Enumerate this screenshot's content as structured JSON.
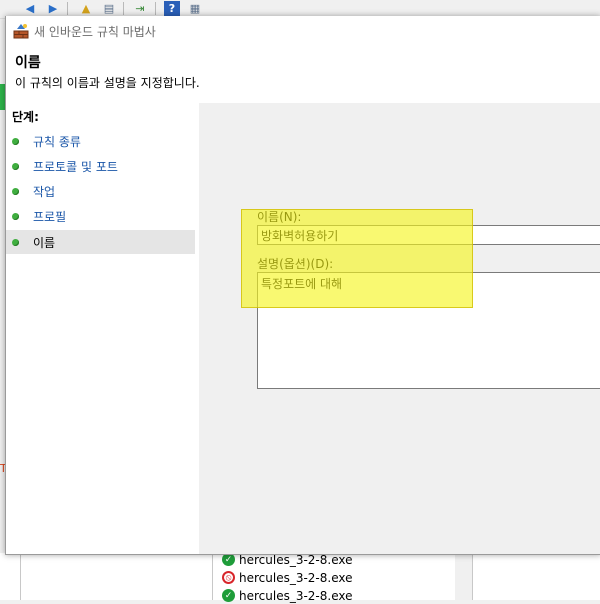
{
  "background_app": {
    "toolbar_icons": [
      "back-arrow-icon",
      "forward-arrow-icon",
      "folder-up-icon",
      "console-tree-icon",
      "export-list-icon",
      "help-icon",
      "properties-icon"
    ],
    "list_items": [
      {
        "name": "hercules_3-2-8.exe",
        "icon": "allow-check-icon"
      },
      {
        "name": "hercules_3-2-8.exe",
        "icon": "block-circle-icon"
      },
      {
        "name": "hercules_3-2-8.exe",
        "icon": "allow-check-icon"
      }
    ]
  },
  "dialog": {
    "title": "새 인바운드 규칙 마법사",
    "header": {
      "title": "이름",
      "description": "이 규칙의 이름과 설명을 지정합니다."
    },
    "steps": {
      "title": "단계:",
      "items": [
        {
          "label": "규칙 종류",
          "current": false
        },
        {
          "label": "프로토콜 및 포트",
          "current": false
        },
        {
          "label": "작업",
          "current": false
        },
        {
          "label": "프로필",
          "current": false
        },
        {
          "label": "이름",
          "current": true
        }
      ]
    },
    "form": {
      "name_label": "이름(N):",
      "name_value": "방화벽허용하기",
      "description_label": "설명(옵션)(D):",
      "description_value": "특정포트에 대해"
    }
  },
  "colors": {
    "step_link": "#1a56a8",
    "step_dot": "#3fae3f",
    "highlight": "#f6f61a"
  }
}
